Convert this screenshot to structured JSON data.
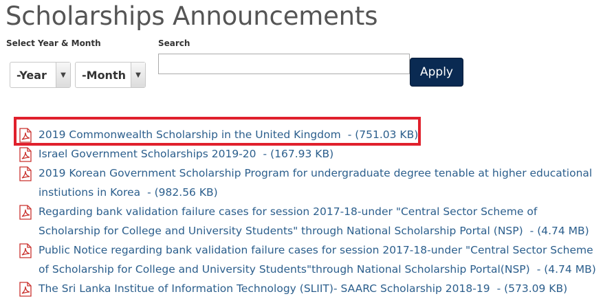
{
  "page": {
    "title": "Scholarships Announcements"
  },
  "filters": {
    "year_month_label": "Select Year & Month",
    "year_value": "-Year",
    "month_value": "-Month",
    "search_label": "Search",
    "search_value": "",
    "apply_label": "Apply"
  },
  "announcements": [
    {
      "title": "2019 Commonwealth Scholarship in the United Kingdom",
      "size": "- (751.03 KB)",
      "icon": "pdf-icon",
      "highlighted": true
    },
    {
      "title": "Israel Government Scholarships 2019-20",
      "size": "- (167.93 KB)",
      "icon": "pdf-icon"
    },
    {
      "title": "2019 Korean Government Scholarship Program for undergraduate degree tenable at higher educational instiutions in Korea",
      "size": "- (982.56 KB)",
      "icon": "pdf-icon"
    },
    {
      "title": "Regarding bank validation failure cases for session 2017-18-under \"Central Sector Scheme of Scholarship for College and University Students\" through National Scholarship Portal (NSP)",
      "size": "- (4.74 MB)",
      "icon": "pdf-icon"
    },
    {
      "title": "Public Notice regarding bank validation failure cases for session 2017-18-under \"Central Sector Scheme of Scholarship for College and University Students\"through National Scholarship Portal(NSP)",
      "size": "- (4.74 MB)",
      "icon": "pdf-icon"
    },
    {
      "title": "The Sri Lanka Institue of Information Technology (SLIIT)- SAARC Scholarship 2018-19",
      "size": "- (573.09 KB)",
      "icon": "pdf-icon"
    }
  ],
  "colors": {
    "link": "#2b5e8c",
    "button_bg": "#0a2a52",
    "highlight": "#e0202c"
  }
}
